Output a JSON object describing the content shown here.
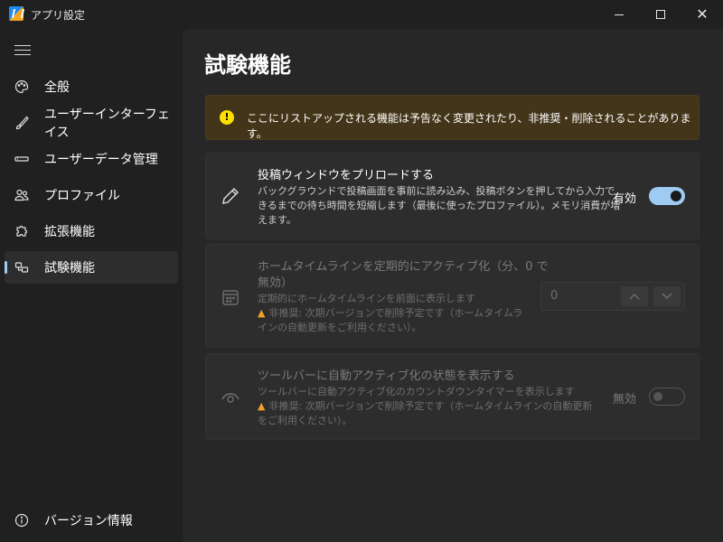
{
  "window": {
    "title": "アプリ設定",
    "icon": "app-logo-icon",
    "controls": [
      "minimize-icon",
      "maximize-icon",
      "close-icon"
    ]
  },
  "sidebar": {
    "menu_icon": "hamburger-icon",
    "items": [
      {
        "label": "全般",
        "icon": "palette-icon",
        "active": false
      },
      {
        "label": "ユーザーインターフェイス",
        "icon": "brush-icon",
        "active": false
      },
      {
        "label": "ユーザーデータ管理",
        "icon": "storage-icon",
        "active": false
      },
      {
        "label": "プロファイル",
        "icon": "people-icon",
        "active": false
      },
      {
        "label": "拡張機能",
        "icon": "puzzle-icon",
        "active": false
      },
      {
        "label": "試験機能",
        "icon": "flask-icon",
        "active": true
      }
    ],
    "footer_item": {
      "label": "バージョン情報",
      "icon": "info-icon"
    }
  },
  "main": {
    "title": "試験機能",
    "info_bar": {
      "icon": "warning-circle-icon",
      "text": "ここにリストアップされる機能は予告なく変更されたり、非推奨・削除されることがあります。"
    },
    "cards": [
      {
        "icon": "pencil-icon",
        "title": "投稿ウィンドウをプリロードする",
        "desc_line1": "バックグラウンドで投稿画面を事前に読み込み、投稿ボタンを押してから入力で",
        "desc_line2": "きるまでの待ち時間を短縮します（最後に使ったプロファイル）。メモリ消費が増",
        "desc_line3": "えます。",
        "toggle_label": "有効",
        "toggle_on": true
      },
      {
        "icon": "calendar-icon",
        "title_line1": "ホームタイムラインを定期的にアクティブ化（分、0 で",
        "title_line2": "無効）",
        "desc": "定期的にホームタイムラインを前面に表示します",
        "warning_line1": "非推奨: 次期バージョンで削除予定です（ホームタイムラ",
        "warning_line2": "インの自動更新をご利用ください）。",
        "number_value": "0",
        "disabled": true
      },
      {
        "icon": "eye-icon",
        "title": "ツールバーに自動アクティブ化の状態を表示する",
        "desc": "ツールバーに自動アクティブ化のカウントダウンタイマーを表示します",
        "warning_line1": "非推奨: 次期バージョンで削除予定です（ホームタイムラインの自動更新",
        "warning_line2": "をご利用ください）。",
        "toggle_label": "無効",
        "toggle_on": false,
        "disabled": true
      }
    ]
  },
  "colors": {
    "accent": "#9ecbf2",
    "window_bg": "#202020",
    "content_bg": "#272727",
    "card_bg": "#2d2d2d",
    "info_bg": "#433519",
    "warning_yellow": "#fce100",
    "warning_orange": "#f0a12a"
  }
}
